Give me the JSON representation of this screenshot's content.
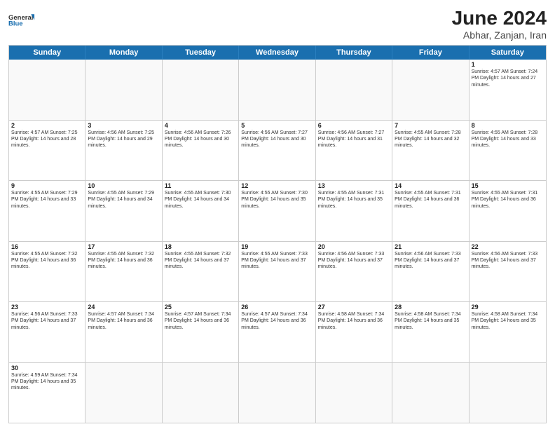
{
  "header": {
    "logo_general": "General",
    "logo_blue": "Blue",
    "month_year": "June 2024",
    "location": "Abhar, Zanjan, Iran"
  },
  "weekdays": [
    "Sunday",
    "Monday",
    "Tuesday",
    "Wednesday",
    "Thursday",
    "Friday",
    "Saturday"
  ],
  "rows": [
    [
      {
        "day": "",
        "info": ""
      },
      {
        "day": "",
        "info": ""
      },
      {
        "day": "",
        "info": ""
      },
      {
        "day": "",
        "info": ""
      },
      {
        "day": "",
        "info": ""
      },
      {
        "day": "",
        "info": ""
      },
      {
        "day": "1",
        "info": "Sunrise: 4:57 AM\nSunset: 7:24 PM\nDaylight: 14 hours\nand 27 minutes."
      }
    ],
    [
      {
        "day": "2",
        "info": "Sunrise: 4:57 AM\nSunset: 7:25 PM\nDaylight: 14 hours\nand 28 minutes."
      },
      {
        "day": "3",
        "info": "Sunrise: 4:56 AM\nSunset: 7:25 PM\nDaylight: 14 hours\nand 29 minutes."
      },
      {
        "day": "4",
        "info": "Sunrise: 4:56 AM\nSunset: 7:26 PM\nDaylight: 14 hours\nand 30 minutes."
      },
      {
        "day": "5",
        "info": "Sunrise: 4:56 AM\nSunset: 7:27 PM\nDaylight: 14 hours\nand 30 minutes."
      },
      {
        "day": "6",
        "info": "Sunrise: 4:56 AM\nSunset: 7:27 PM\nDaylight: 14 hours\nand 31 minutes."
      },
      {
        "day": "7",
        "info": "Sunrise: 4:55 AM\nSunset: 7:28 PM\nDaylight: 14 hours\nand 32 minutes."
      },
      {
        "day": "8",
        "info": "Sunrise: 4:55 AM\nSunset: 7:28 PM\nDaylight: 14 hours\nand 33 minutes."
      }
    ],
    [
      {
        "day": "9",
        "info": "Sunrise: 4:55 AM\nSunset: 7:29 PM\nDaylight: 14 hours\nand 33 minutes."
      },
      {
        "day": "10",
        "info": "Sunrise: 4:55 AM\nSunset: 7:29 PM\nDaylight: 14 hours\nand 34 minutes."
      },
      {
        "day": "11",
        "info": "Sunrise: 4:55 AM\nSunset: 7:30 PM\nDaylight: 14 hours\nand 34 minutes."
      },
      {
        "day": "12",
        "info": "Sunrise: 4:55 AM\nSunset: 7:30 PM\nDaylight: 14 hours\nand 35 minutes."
      },
      {
        "day": "13",
        "info": "Sunrise: 4:55 AM\nSunset: 7:31 PM\nDaylight: 14 hours\nand 35 minutes."
      },
      {
        "day": "14",
        "info": "Sunrise: 4:55 AM\nSunset: 7:31 PM\nDaylight: 14 hours\nand 36 minutes."
      },
      {
        "day": "15",
        "info": "Sunrise: 4:55 AM\nSunset: 7:31 PM\nDaylight: 14 hours\nand 36 minutes."
      }
    ],
    [
      {
        "day": "16",
        "info": "Sunrise: 4:55 AM\nSunset: 7:32 PM\nDaylight: 14 hours\nand 36 minutes."
      },
      {
        "day": "17",
        "info": "Sunrise: 4:55 AM\nSunset: 7:32 PM\nDaylight: 14 hours\nand 36 minutes."
      },
      {
        "day": "18",
        "info": "Sunrise: 4:55 AM\nSunset: 7:32 PM\nDaylight: 14 hours\nand 37 minutes."
      },
      {
        "day": "19",
        "info": "Sunrise: 4:55 AM\nSunset: 7:33 PM\nDaylight: 14 hours\nand 37 minutes."
      },
      {
        "day": "20",
        "info": "Sunrise: 4:56 AM\nSunset: 7:33 PM\nDaylight: 14 hours\nand 37 minutes."
      },
      {
        "day": "21",
        "info": "Sunrise: 4:56 AM\nSunset: 7:33 PM\nDaylight: 14 hours\nand 37 minutes."
      },
      {
        "day": "22",
        "info": "Sunrise: 4:56 AM\nSunset: 7:33 PM\nDaylight: 14 hours\nand 37 minutes."
      }
    ],
    [
      {
        "day": "23",
        "info": "Sunrise: 4:56 AM\nSunset: 7:33 PM\nDaylight: 14 hours\nand 37 minutes."
      },
      {
        "day": "24",
        "info": "Sunrise: 4:57 AM\nSunset: 7:34 PM\nDaylight: 14 hours\nand 36 minutes."
      },
      {
        "day": "25",
        "info": "Sunrise: 4:57 AM\nSunset: 7:34 PM\nDaylight: 14 hours\nand 36 minutes."
      },
      {
        "day": "26",
        "info": "Sunrise: 4:57 AM\nSunset: 7:34 PM\nDaylight: 14 hours\nand 36 minutes."
      },
      {
        "day": "27",
        "info": "Sunrise: 4:58 AM\nSunset: 7:34 PM\nDaylight: 14 hours\nand 36 minutes."
      },
      {
        "day": "28",
        "info": "Sunrise: 4:58 AM\nSunset: 7:34 PM\nDaylight: 14 hours\nand 35 minutes."
      },
      {
        "day": "29",
        "info": "Sunrise: 4:58 AM\nSunset: 7:34 PM\nDaylight: 14 hours\nand 35 minutes."
      }
    ],
    [
      {
        "day": "30",
        "info": "Sunrise: 4:59 AM\nSunset: 7:34 PM\nDaylight: 14 hours\nand 35 minutes."
      },
      {
        "day": "",
        "info": ""
      },
      {
        "day": "",
        "info": ""
      },
      {
        "day": "",
        "info": ""
      },
      {
        "day": "",
        "info": ""
      },
      {
        "day": "",
        "info": ""
      },
      {
        "day": "",
        "info": ""
      }
    ]
  ]
}
